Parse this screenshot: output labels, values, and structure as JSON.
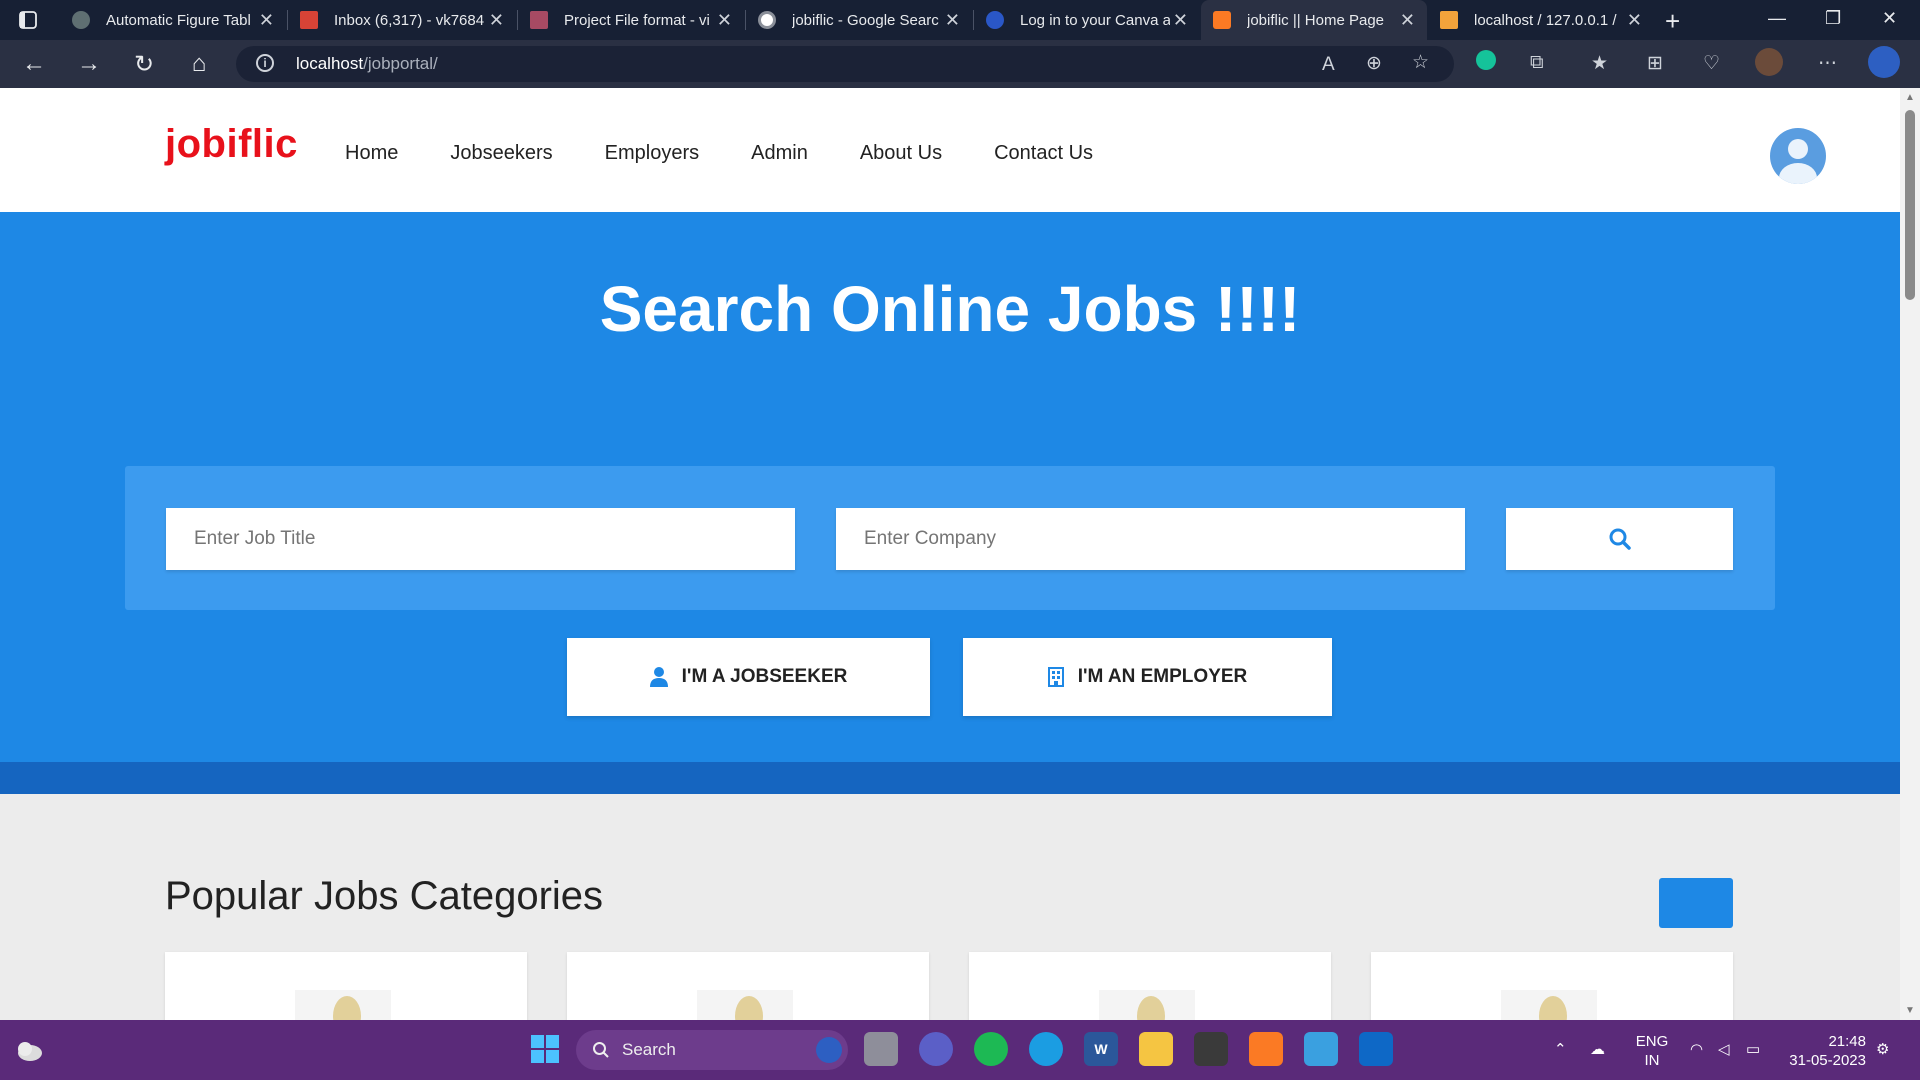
{
  "browser": {
    "tabs": [
      {
        "title": "Automatic Figure Tabl",
        "active": false
      },
      {
        "title": "Inbox (6,317) - vk7684",
        "active": false
      },
      {
        "title": "Project File format - vi",
        "active": false
      },
      {
        "title": "jobiflic - Google Searc",
        "active": false
      },
      {
        "title": "Log in to your Canva a",
        "active": false
      },
      {
        "title": "jobiflic || Home Page",
        "active": true
      },
      {
        "title": "localhost / 127.0.0.1 /",
        "active": false
      }
    ],
    "url_host": "localhost",
    "url_path": "/jobportal/"
  },
  "site": {
    "logo": "jobiflic",
    "nav": [
      "Home",
      "Jobseekers",
      "Employers",
      "Admin",
      "About Us",
      "Contact Us"
    ]
  },
  "hero": {
    "title": "Search Online Jobs !!!!",
    "job_title_placeholder": "Enter Job Title",
    "company_placeholder": "Enter Company",
    "jobseeker_button": "I'M A JOBSEEKER",
    "employer_button": "I'M AN EMPLOYER"
  },
  "categories": {
    "title": "Popular Jobs Categories"
  },
  "taskbar": {
    "search_label": "Search",
    "lang_line1": "ENG",
    "lang_line2": "IN",
    "time": "21:48",
    "date": "31-05-2023"
  },
  "colors": {
    "brand_red": "#e8111b",
    "hero_blue": "#1e88e5",
    "taskbar_purple": "#5a2a79"
  }
}
